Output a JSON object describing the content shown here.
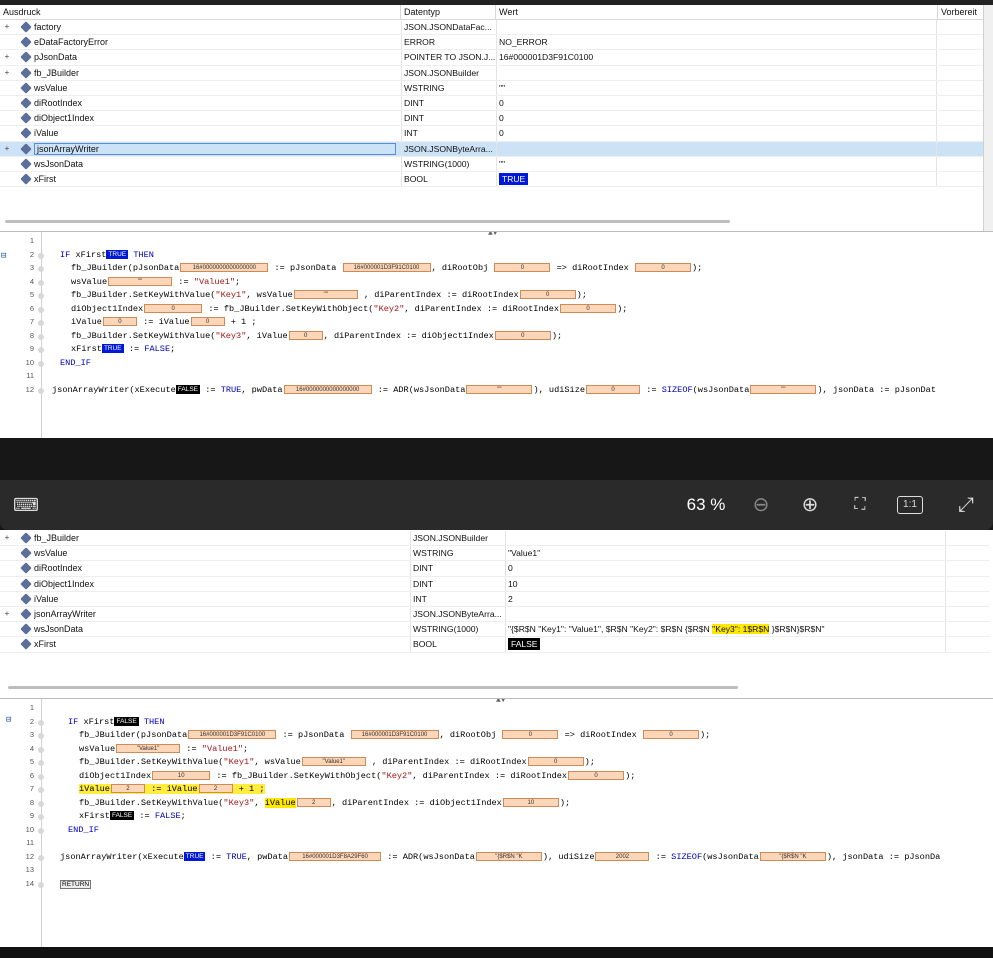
{
  "watch_top": {
    "columns": {
      "expression": "Ausdruck",
      "datatype": "Datentyp",
      "value": "Wert",
      "prepared": "Vorbereit"
    },
    "rows": [
      {
        "name": "factory",
        "type": "JSON.JSONDataFac...",
        "value": "",
        "expand": "+"
      },
      {
        "name": "eDataFactoryError",
        "type": "ERROR",
        "value": "NO_ERROR",
        "expand": ""
      },
      {
        "name": "pJsonData",
        "type": "POINTER TO JSON.J...",
        "value": "16#000001D3F91C0100",
        "expand": "+"
      },
      {
        "name": "fb_JBuilder",
        "type": "JSON.JSONBuilder",
        "value": "",
        "expand": "+"
      },
      {
        "name": "wsValue",
        "type": "WSTRING",
        "value": "\"\"",
        "expand": ""
      },
      {
        "name": "diRootIndex",
        "type": "DINT",
        "value": "0",
        "expand": ""
      },
      {
        "name": "diObject1Index",
        "type": "DINT",
        "value": "0",
        "expand": ""
      },
      {
        "name": "iValue",
        "type": "INT",
        "value": "0",
        "expand": ""
      },
      {
        "name": "jsonArrayWriter",
        "type": "JSON.JSONByteArra...",
        "value": "",
        "expand": "+"
      },
      {
        "name": "wsJsonData",
        "type": "WSTRING(1000)",
        "value": "\"\"",
        "expand": ""
      },
      {
        "name": "xFirst",
        "type": "BOOL",
        "value": "TRUE",
        "expand": ""
      }
    ]
  },
  "code_top": {
    "line_numbers": [
      "1",
      "2",
      "3",
      "4",
      "5",
      "6",
      "7",
      "8",
      "9",
      "10",
      "11",
      "12"
    ],
    "l2": {
      "kw_if": "IF",
      "var": "xFirst",
      "val": "TRUE",
      "kw_then": "THEN"
    },
    "l3": {
      "a": "fb_JBuilder(pJsonData",
      "v1": "16#0000000000000000",
      "b": ":= pJsonData",
      "v2": "16#000001D3F91C0100",
      "c": ", diRootObj",
      "v3": "0",
      "d": "=> diRootIndex",
      "v4": "0",
      "e": ");"
    },
    "l4": {
      "a": "wsValue",
      "v1": "\"\"",
      "b": ":=",
      "s": "\"Value1\"",
      "e": ";"
    },
    "l5": {
      "a": "fb_JBuilder.SetKeyWithValue(",
      "s": "\"Key1\"",
      "b": ", wsValue",
      "v1": "\"\"",
      "c": ", diParentIndex := diRootIndex",
      "v2": "0",
      "e": ");"
    },
    "l6": {
      "a": "diObject1Index",
      "v1": "0",
      "b": ":= fb_JBuilder.SetKeyWithObject(",
      "s": "\"Key2\"",
      "c": ", diParentIndex := diRootIndex",
      "v2": "0",
      "e": ");"
    },
    "l7": {
      "a": "iValue",
      "v1": "0",
      "b": ":= iValue",
      "v2": "0",
      "c": "+ 1 ;"
    },
    "l8": {
      "a": "fb_JBuilder.SetKeyWithValue(",
      "s": "\"Key3\"",
      "b": ", iValue",
      "v1": "0",
      "c": ", diParentIndex := diObject1Index",
      "v2": "0",
      "e": ");"
    },
    "l9": {
      "a": "xFirst",
      "val": "TRUE",
      "b": ":=",
      "kw": "FALSE",
      "e": ";"
    },
    "l10": {
      "kw": "END_IF"
    },
    "l12": {
      "a": "jsonArrayWriter(xExecute",
      "val": "FALSE",
      "b": ":=",
      "kw": "TRUE",
      "c": ", pwData",
      "v1": "16#0000000000000000",
      "d": ":= ADR(wsJsonData",
      "v2": "\"\"",
      "e": "), udiSize",
      "v3": "0",
      "f": ":=",
      "kw2": "SIZEOF",
      "g": "(wsJsonData",
      "v4": "\"\"",
      "h": "), jsonData := pJsonDat"
    }
  },
  "zoom": {
    "percent": "63 %",
    "zoom_out": "zoom-out",
    "zoom_in": "zoom-in",
    "fit": "fit",
    "one": "1:1",
    "expand": "expand"
  },
  "watch_bottom": {
    "rows": [
      {
        "name": "fb_JBuilder",
        "type": "JSON.JSONBuilder",
        "value": "",
        "expand": "+"
      },
      {
        "name": "wsValue",
        "type": "WSTRING",
        "value": "\"Value1\"",
        "expand": ""
      },
      {
        "name": "diRootIndex",
        "type": "DINT",
        "value": "0",
        "expand": ""
      },
      {
        "name": "diObject1Index",
        "type": "DINT",
        "value": "10",
        "expand": ""
      },
      {
        "name": "iValue",
        "type": "INT",
        "value": "2",
        "expand": ""
      },
      {
        "name": "jsonArrayWriter",
        "type": "JSON.JSONByteArra...",
        "value": "",
        "expand": "+"
      },
      {
        "name": "wsJsonData",
        "type": "WSTRING(1000)",
        "value_a": "\"{$R$N  \"Key1\": \"Value1\", $R$N  \"Key2\": $R$N    {$R$N      ",
        "value_hl": "\"Key3\": 1$R$N",
        "value_b": "    }$R$N}$R$N\"",
        "expand": ""
      },
      {
        "name": "xFirst",
        "type": "BOOL",
        "value": "FALSE",
        "expand": ""
      }
    ]
  },
  "code_bottom": {
    "line_numbers": [
      "1",
      "2",
      "3",
      "4",
      "5",
      "6",
      "7",
      "8",
      "9",
      "10",
      "11",
      "12",
      "13",
      "14"
    ],
    "l2": {
      "kw_if": "IF",
      "var": "xFirst",
      "val": "FALSE",
      "kw_then": "THEN"
    },
    "l3": {
      "a": "fb_JBuilder(pJsonData",
      "v1": "16#000001D3F91C0100",
      "b": ":= pJsonData",
      "v2": "16#000001D3F91C0100",
      "c": ", diRootObj",
      "v3": "0",
      "d": "=> diRootIndex",
      "v4": "0",
      "e": ");"
    },
    "l4": {
      "a": "wsValue",
      "v1": "\"Value1\"",
      "b": ":=",
      "s": "\"Value1\"",
      "e": ";"
    },
    "l5": {
      "a": "fb_JBuilder.SetKeyWithValue(",
      "s": "\"Key1\"",
      "b": ", wsValue",
      "v1": "\"Value1\"",
      "c": ", diParentIndex := diRootIndex",
      "v2": "0",
      "e": ");"
    },
    "l6": {
      "a": "diObject1Index",
      "v1": "10",
      "b": ":= fb_JBuilder.SetKeyWithObject(",
      "s": "\"Key2\"",
      "c": ", diParentIndex := diRootIndex",
      "v2": "0",
      "e": ");"
    },
    "l7": {
      "a": "iValue",
      "v1": "2",
      "b": ":= iValue",
      "v2": "2",
      "c": "+ 1 ;"
    },
    "l8": {
      "a": "fb_JBuilder.SetKeyWithValue(",
      "s": "\"Key3\"",
      "b": ", ",
      "hl": "iValue",
      "v1": "2",
      "c": ", diParentIndex := diObject1Index",
      "v2": "10",
      "e": ");"
    },
    "l9": {
      "a": "xFirst",
      "val": "FALSE",
      "b": ":=",
      "kw": "FALSE",
      "e": ";"
    },
    "l10": {
      "kw": "END_IF"
    },
    "l12": {
      "a": "jsonArrayWriter(xExecute",
      "val": "TRUE",
      "b": ":=",
      "kw": "TRUE",
      "c": ", pwData",
      "v1": "16#000001D3F8A29F60",
      "d": ":= ADR(wsJsonData",
      "v2": "\"{$R$N  \"K",
      "e": "), udiSize",
      "v3": "2002",
      "f": ":=",
      "kw2": "SIZEOF",
      "g": "(wsJsonData",
      "v4": "\"{$R$N  \"K",
      "h": "), jsonData := pJsonDa"
    },
    "l14": {
      "ret": "RETURN"
    }
  }
}
